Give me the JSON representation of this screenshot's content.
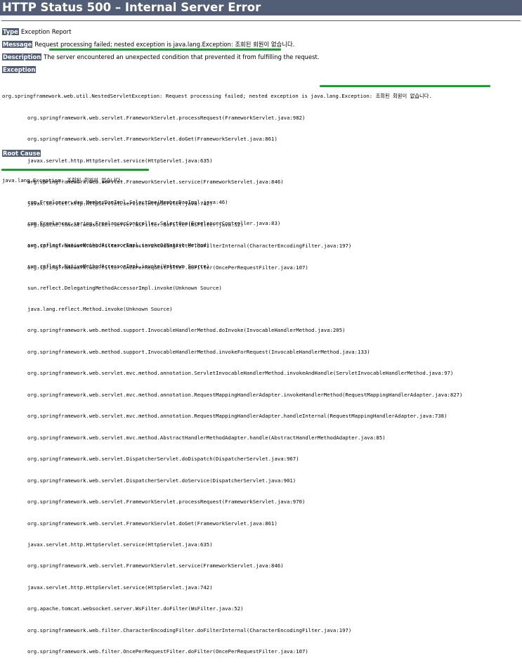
{
  "title": "HTTP Status 500 – Internal Server Error",
  "type": {
    "label": "Type",
    "value": "Exception Report"
  },
  "message": {
    "label": "Message",
    "value": "Request processing failed; nested exception is java.lang.Exception: 조회된 회원이 없습니다."
  },
  "description": {
    "label": "Description",
    "value": "The server encountered an unexpected condition that prevented it from fulfilling the request."
  },
  "exception_heading": "Exception",
  "exception_trace": [
    "org.springframework.web.util.NestedServletException: Request processing failed; nested exception is java.lang.Exception: 조회된 회원이 없습니다.",
    "org.springframework.web.servlet.FrameworkServlet.processRequest(FrameworkServlet.java:982)",
    "org.springframework.web.servlet.FrameworkServlet.doGet(FrameworkServlet.java:861)",
    "javax.servlet.http.HttpServlet.service(HttpServlet.java:635)",
    "org.springframework.web.servlet.FrameworkServlet.service(FrameworkServlet.java:846)",
    "javax.servlet.http.HttpServlet.service(HttpServlet.java:742)",
    "org.apache.tomcat.websocket.server.WsFilter.doFilter(WsFilter.java:52)",
    "org.springframework.web.filter.CharacterEncodingFilter.doFilterInternal(CharacterEncodingFilter.java:197)",
    "org.springframework.web.filter.OncePerRequestFilter.doFilter(OncePerRequestFilter.java:107)"
  ],
  "root_cause_heading": "Root Cause",
  "root_cause_trace": [
    "java.lang.Exception: 조회된 회원이 없습니다.",
    "com.Freelancer.dao.MemberDaoImpl.SelectOne(MemberDaoImpl.java:46)",
    "com.Freelancer.spring.FreelancerController.SelectOne(FreelancerController.java:83)",
    "sun.reflect.NativeMethodAccessorImpl.invoke0(Native Method)",
    "sun.reflect.NativeMethodAccessorImpl.invoke(Unknown Source)",
    "sun.reflect.DelegatingMethodAccessorImpl.invoke(Unknown Source)",
    "java.lang.reflect.Method.invoke(Unknown Source)",
    "org.springframework.web.method.support.InvocableHandlerMethod.doInvoke(InvocableHandlerMethod.java:205)",
    "org.springframework.web.method.support.InvocableHandlerMethod.invokeForRequest(InvocableHandlerMethod.java:133)",
    "org.springframework.web.servlet.mvc.method.annotation.ServletInvocableHandlerMethod.invokeAndHandle(ServletInvocableHandlerMethod.java:97)",
    "org.springframework.web.servlet.mvc.method.annotation.RequestMappingHandlerAdapter.invokeHandlerMethod(RequestMappingHandlerAdapter.java:827)",
    "org.springframework.web.servlet.mvc.method.annotation.RequestMappingHandlerAdapter.handleInternal(RequestMappingHandlerAdapter.java:738)",
    "org.springframework.web.servlet.mvc.method.AbstractHandlerMethodAdapter.handle(AbstractHandlerMethodAdapter.java:85)",
    "org.springframework.web.servlet.DispatcherServlet.doDispatch(DispatcherServlet.java:967)",
    "org.springframework.web.servlet.DispatcherServlet.doService(DispatcherServlet.java:901)",
    "org.springframework.web.servlet.FrameworkServlet.processRequest(FrameworkServlet.java:970)",
    "org.springframework.web.servlet.FrameworkServlet.doGet(FrameworkServlet.java:861)",
    "javax.servlet.http.HttpServlet.service(HttpServlet.java:635)",
    "org.springframework.web.servlet.FrameworkServlet.service(FrameworkServlet.java:846)",
    "javax.servlet.http.HttpServlet.service(HttpServlet.java:742)",
    "org.apache.tomcat.websocket.server.WsFilter.doFilter(WsFilter.java:52)",
    "org.springframework.web.filter.CharacterEncodingFilter.doFilterInternal(CharacterEncodingFilter.java:197)",
    "org.springframework.web.filter.OncePerRequestFilter.doFilter(OncePerRequestFilter.java:107)"
  ],
  "colors": {
    "header_bg": "#525d76",
    "header_text": "#ffffff",
    "highlight_mark": "#17a32b"
  }
}
